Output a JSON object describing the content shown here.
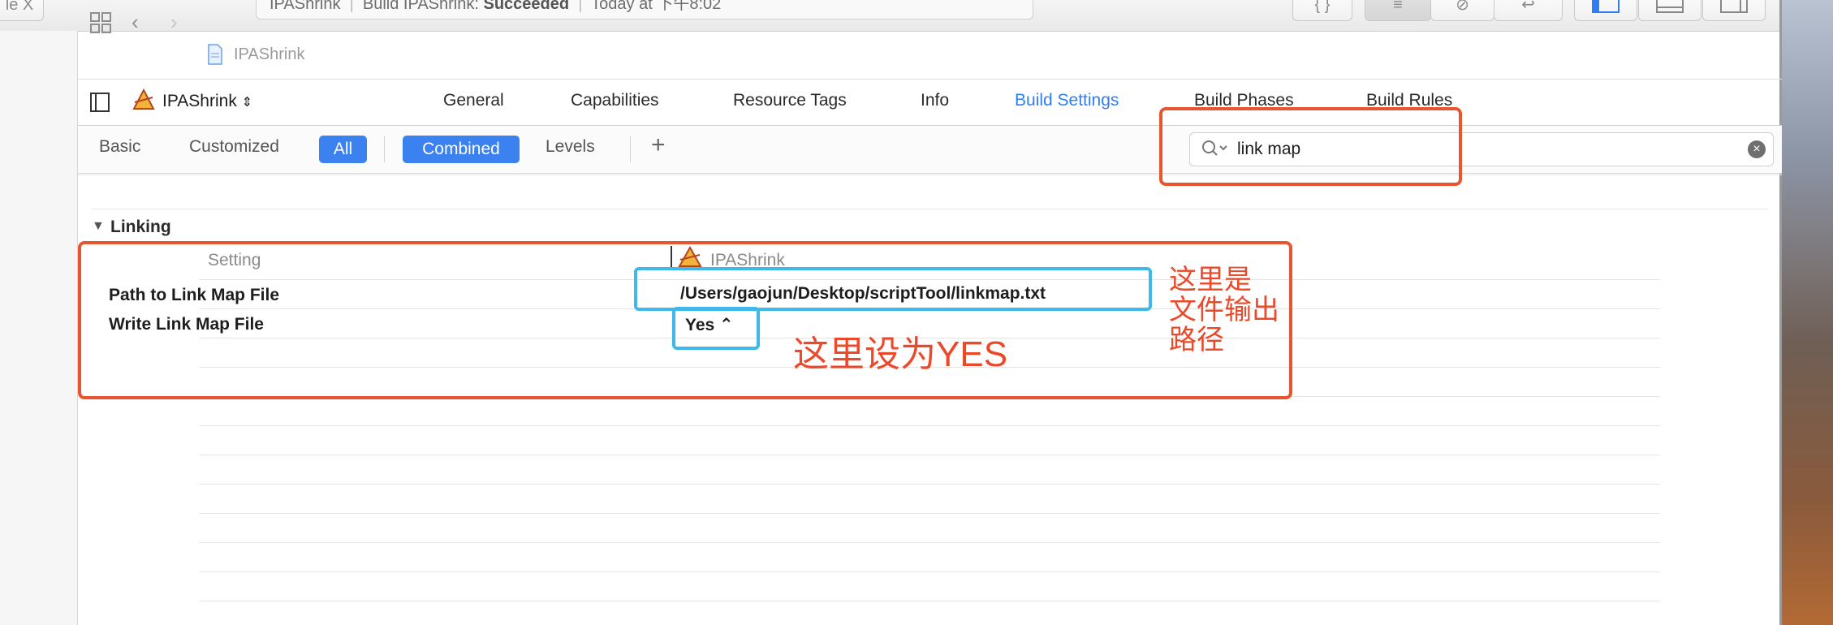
{
  "toolbar": {
    "scheme_fragment": "le X",
    "activity": {
      "project": "IPAShrink",
      "build_prefix": "Build IPAShrink: ",
      "build_state": "Succeeded",
      "time": "Today at 下午8:02"
    },
    "buttons": [
      "{ }",
      "≡",
      "⊘",
      "↩"
    ]
  },
  "jumpbar": {
    "crumb": "IPAShrink"
  },
  "target": {
    "name": "IPAShrink",
    "selector_glyph": "⌃"
  },
  "tabs": [
    {
      "label": "General"
    },
    {
      "label": "Capabilities"
    },
    {
      "label": "Resource Tags"
    },
    {
      "label": "Info"
    },
    {
      "label": "Build Settings",
      "active": true
    },
    {
      "label": "Build Phases"
    },
    {
      "label": "Build Rules"
    }
  ],
  "filter": {
    "basic": "Basic",
    "customized": "Customized",
    "all": "All",
    "combined": "Combined",
    "levels": "Levels",
    "add": "+"
  },
  "search": {
    "value": "link map"
  },
  "section": {
    "title": "Linking",
    "col_setting": "Setting",
    "col_target": "IPAShrink",
    "rows": [
      {
        "label": "Path to Link Map File",
        "value": "/Users/gaojun/Desktop/scriptTool/linkmap.txt"
      },
      {
        "label": "Write Link Map File",
        "value": "Yes ⌃"
      }
    ]
  },
  "annotations": {
    "set_yes": "这里设为YES",
    "output_path_line1": "这里是",
    "output_path_line2": "文件输出",
    "output_path_line3": "路径"
  },
  "colors": {
    "accent": "#3b82f0",
    "annotation_red": "#e8562f",
    "annotation_blue": "#3fb8ea"
  }
}
